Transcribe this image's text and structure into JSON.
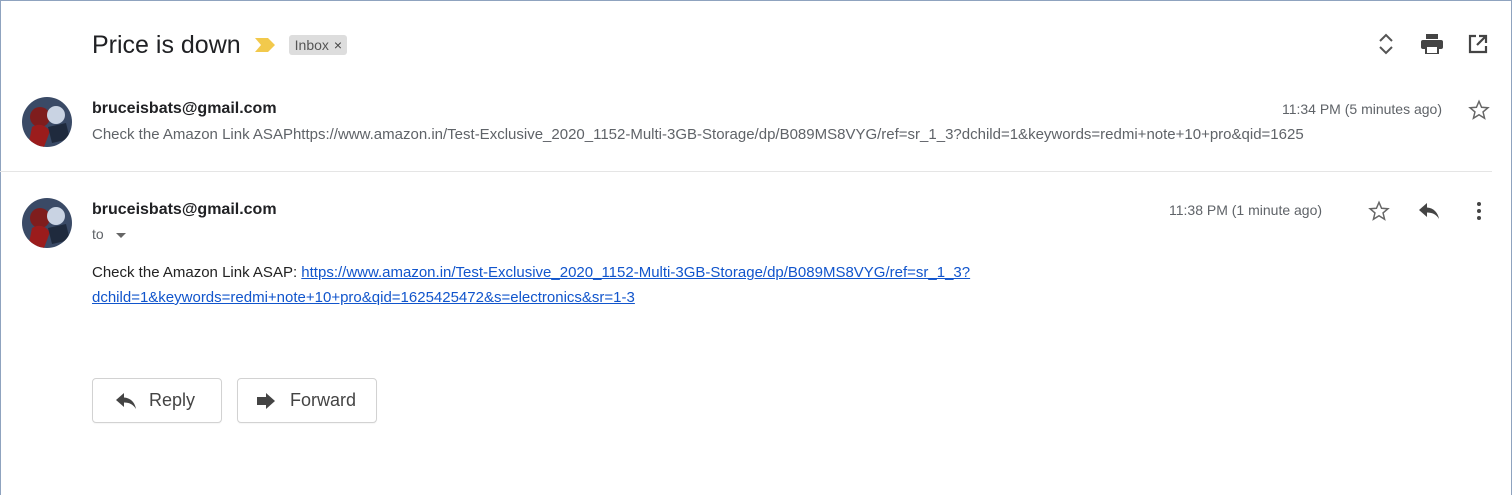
{
  "thread": {
    "subject": "Price is down",
    "label": "Inbox",
    "label_remove": "×",
    "importance_color": "#f2c94c"
  },
  "messages": [
    {
      "sender": "bruceisbats@gmail.com",
      "time": "11:34 PM (5 minutes ago)",
      "snippet": "Check the Amazon Link ASAPhttps://www.amazon.in/Test-Exclusive_2020_1152-Multi-3GB-Storage/dp/B089MS8VYG/ref=sr_1_3?dchild=1&keywords=redmi+note+10+pro&qid=1625"
    },
    {
      "sender": "bruceisbats@gmail.com",
      "time": "11:38 PM (1 minute ago)",
      "to_label": "to",
      "body_prefix": "Check the Amazon Link ASAP: ",
      "body_link": "https://www.amazon.in/Test-Exclusive_2020_1152-Multi-3GB-Storage/dp/B089MS8VYG/ref=sr_1_3?dchild=1&keywords=redmi+note+10+pro&qid=1625425472&s=electronics&sr=1-3"
    }
  ],
  "actions": {
    "reply_label": "Reply",
    "forward_label": "Forward"
  },
  "icons": {
    "expand": "unfold-icon",
    "print": "print-icon",
    "open_new_window": "open-in-new-icon",
    "star": "star-icon",
    "reply": "reply-icon",
    "more": "more-vert-icon",
    "forward": "forward-icon"
  },
  "colors": {
    "link": "#1155cc",
    "label_chip_bg": "#dddddd"
  }
}
